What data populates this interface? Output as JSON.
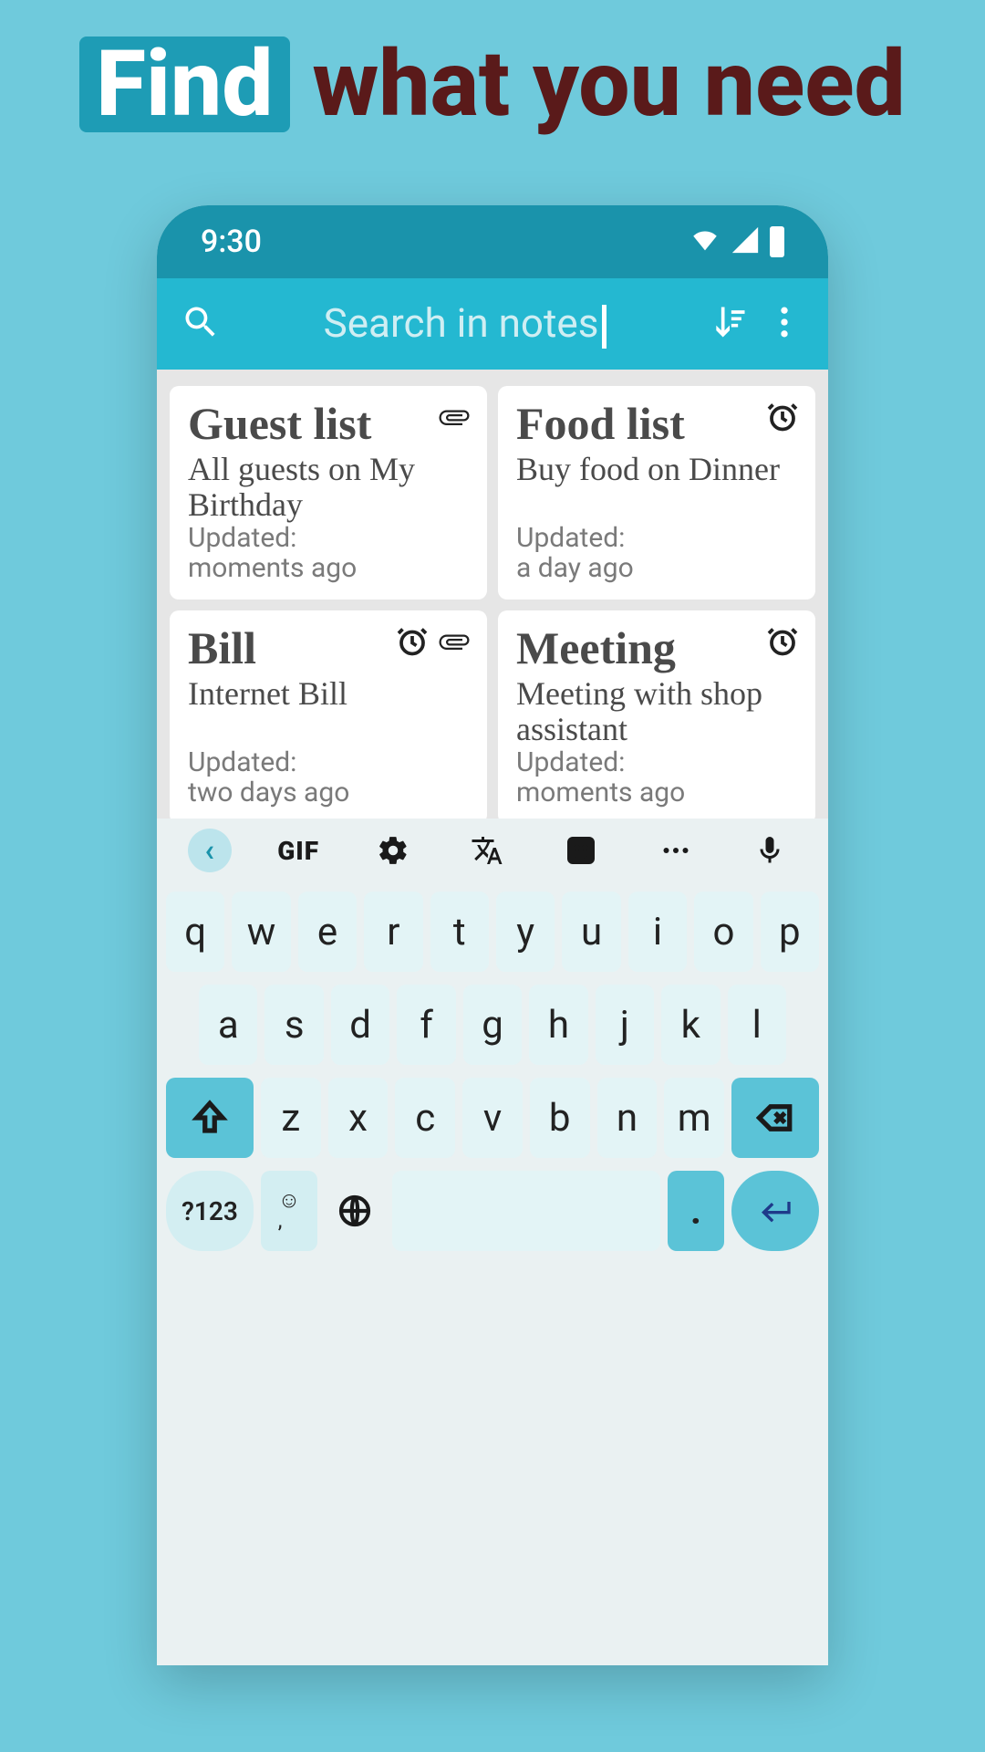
{
  "headline": {
    "highlighted": "Find",
    "rest": " what you need"
  },
  "status": {
    "time": "9:30"
  },
  "search": {
    "placeholder": "Search in notes"
  },
  "notes": [
    {
      "title": "Guest list",
      "body": "All guests on My Birthday",
      "updated": "Updated:\nmoments ago",
      "has_attachment": true,
      "has_alarm": false
    },
    {
      "title": "Food list",
      "body": "Buy food on Dinner",
      "updated": "Updated:\na day ago",
      "has_attachment": false,
      "has_alarm": true
    },
    {
      "title": "Bill",
      "body": "Internet Bill",
      "updated": "Updated:\ntwo days ago",
      "has_attachment": true,
      "has_alarm": true
    },
    {
      "title": "Meeting",
      "body": "Meeting with shop assistant",
      "updated": "Updated:\nmoments ago",
      "has_attachment": false,
      "has_alarm": true
    }
  ],
  "keyboard": {
    "toolbar": {
      "gif": "GIF"
    },
    "row1": [
      "q",
      "w",
      "e",
      "r",
      "t",
      "y",
      "u",
      "i",
      "o",
      "p"
    ],
    "row2": [
      "a",
      "s",
      "d",
      "f",
      "g",
      "h",
      "j",
      "k",
      "l"
    ],
    "row3": [
      "z",
      "x",
      "c",
      "v",
      "b",
      "n",
      "m"
    ],
    "num": "?123",
    "period": "."
  }
}
